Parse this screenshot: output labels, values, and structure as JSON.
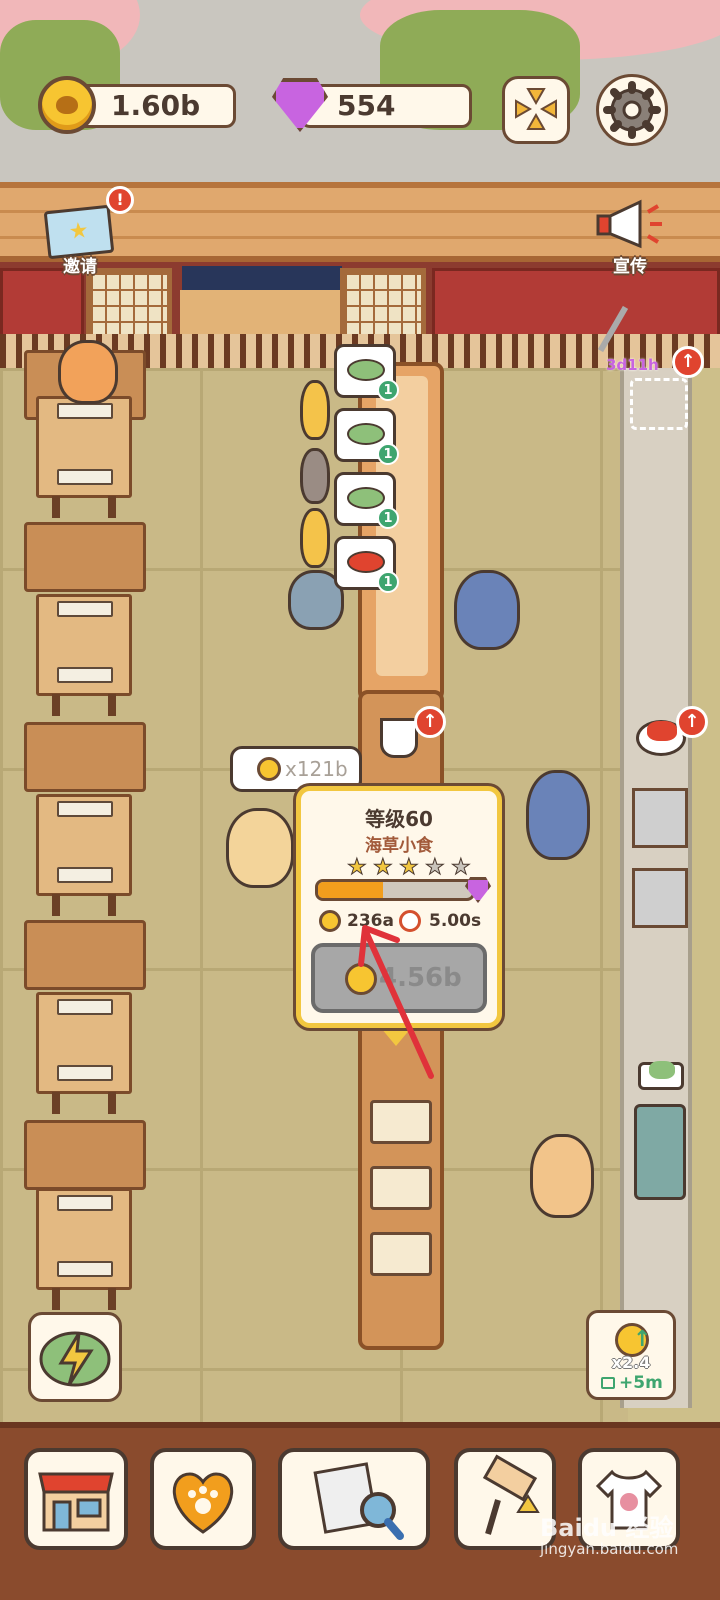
{
  "hud": {
    "coins": "1.60b",
    "gems": "554"
  },
  "side": {
    "invite_label": "邀请",
    "invite_alert": "!",
    "promo_label": "宣传",
    "fishing_timer": "3d11h"
  },
  "orders": [
    {
      "count": "1"
    },
    {
      "count": "1"
    },
    {
      "count": "1"
    },
    {
      "count": "1"
    }
  ],
  "customer_bubble": {
    "amount": "x121b"
  },
  "upgrade_popup": {
    "level": "等级60",
    "dish_name": "海草小食",
    "stars_filled": 3,
    "stars_total": 5,
    "progress": 0.42,
    "income": "236a",
    "time": "5.00s",
    "cost": "4.56b"
  },
  "boost": {
    "multiplier": "x2.4",
    "time": "+5m"
  },
  "watermark": {
    "brand": "Baidu 经验",
    "url": "jingyan.baidu.com"
  },
  "colors": {
    "coin": "#f7c531",
    "gem": "#c864e0",
    "progress": "#f29e1d",
    "alert": "#e0442f",
    "popup_border": "#f2c740"
  }
}
